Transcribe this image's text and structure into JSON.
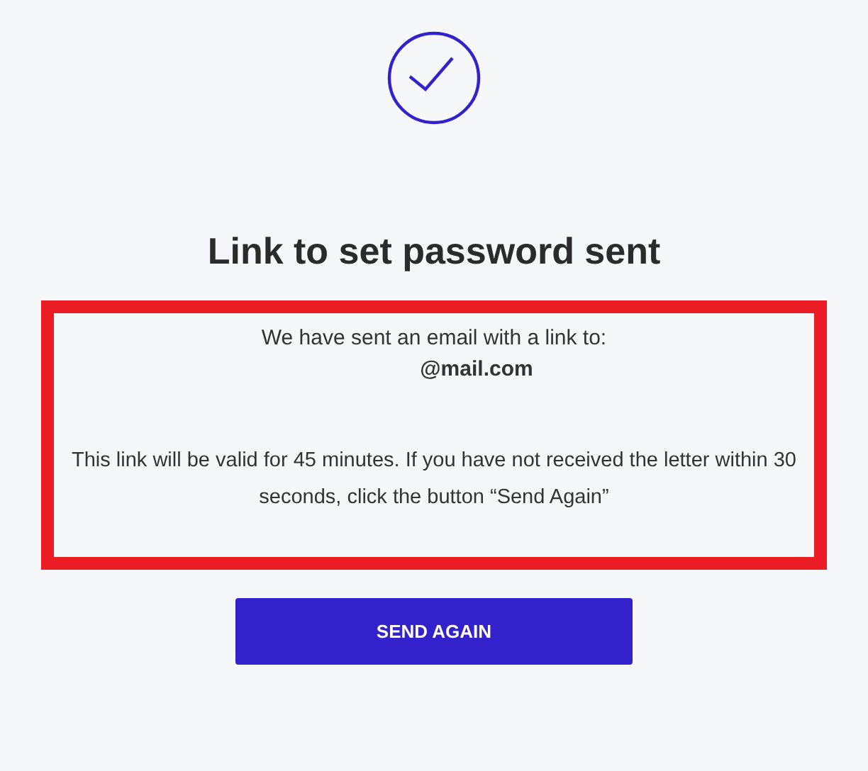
{
  "title": "Link to set password sent",
  "message": {
    "intro": "We have sent an email with a link to:",
    "email": "@mail.com",
    "note": "This link will be valid for 45 minutes. If you have not received the letter within 30 seconds, click the button “Send Again”"
  },
  "button": "SEND AGAIN"
}
